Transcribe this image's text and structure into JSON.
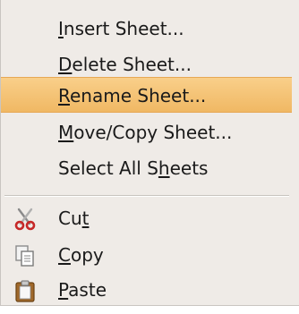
{
  "menu": {
    "items": [
      {
        "pre": "",
        "ul": "I",
        "post": "nsert Sheet..."
      },
      {
        "pre": "",
        "ul": "D",
        "post": "elete Sheet..."
      },
      {
        "pre": "",
        "ul": "R",
        "post": "ename Sheet..."
      },
      {
        "pre": "",
        "ul": "M",
        "post": "ove/Copy Sheet..."
      },
      {
        "pre": "Select All S",
        "ul": "h",
        "post": "eets"
      },
      {
        "pre": "Cu",
        "ul": "t",
        "post": "",
        "icon": "scissors-icon"
      },
      {
        "pre": "",
        "ul": "C",
        "post": "opy",
        "icon": "copy-icon"
      },
      {
        "pre": "",
        "ul": "P",
        "post": "aste",
        "icon": "clipboard-icon"
      }
    ],
    "highlighted": "Rename Sheet...",
    "highlight_color": "#f4c27a"
  }
}
